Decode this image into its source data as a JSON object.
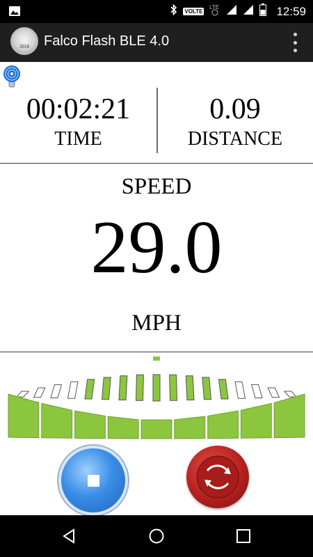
{
  "status_bar": {
    "time": "12:59",
    "volte_label": "VOLTE",
    "icons": [
      "image-icon",
      "bluetooth-icon",
      "lte-icon",
      "signal-icon",
      "signal-icon",
      "battery-icon"
    ]
  },
  "app_bar": {
    "title": "Falco Flash BLE 4.0",
    "logo_year": "2018",
    "menu_icon": "overflow-menu-icon"
  },
  "stats": {
    "time_value": "00:02:21",
    "time_label": "TIME",
    "distance_value": "0.09",
    "distance_label": "DISTANCE"
  },
  "speed": {
    "label": "SPEED",
    "value": "29.0",
    "unit": "MPH"
  },
  "gauge": {
    "segments_total": 17,
    "segments_active": 9,
    "active_color": "#8cc63f",
    "inactive_color": "#ffffff",
    "outline_color": "#555555"
  },
  "controls": {
    "stop_icon": "stop-icon",
    "reset_icon": "reset-icon",
    "stop_color": "#3a8ee6",
    "reset_color": "#b5211f"
  },
  "nav": {
    "icons": [
      "back-icon",
      "home-icon",
      "recents-icon"
    ]
  }
}
